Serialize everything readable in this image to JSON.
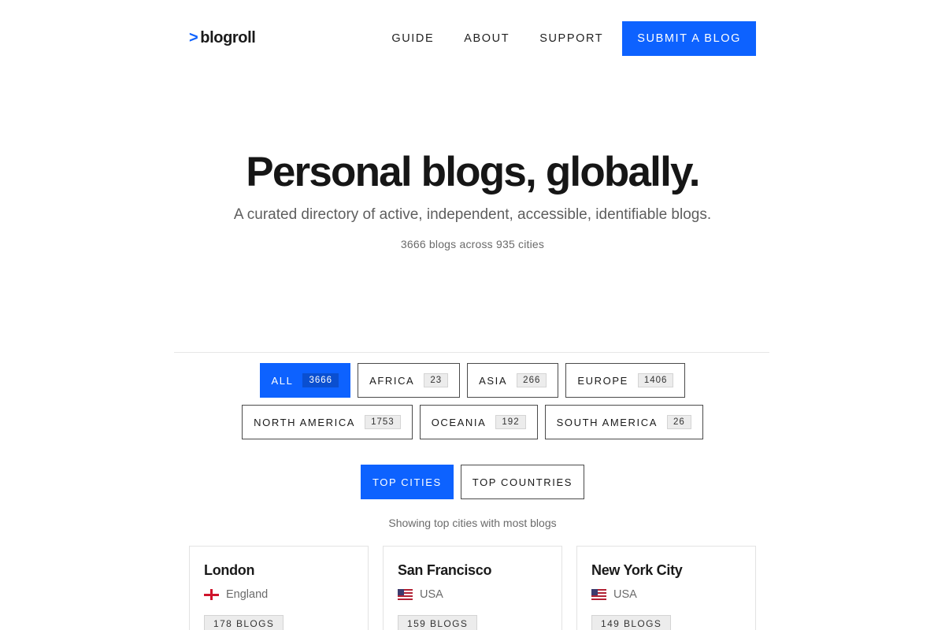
{
  "header": {
    "logo_caret": ">",
    "logo_text": "blogroll",
    "nav": [
      "GUIDE",
      "ABOUT",
      "SUPPORT"
    ],
    "submit_label": "SUBMIT A BLOG"
  },
  "hero": {
    "title": "Personal blogs, globally.",
    "subtitle": "A curated directory of active, independent, accessible, identifiable blogs.",
    "count": "3666 blogs across 935 cities"
  },
  "regions": [
    {
      "label": "ALL",
      "count": "3666",
      "active": true
    },
    {
      "label": "AFRICA",
      "count": "23"
    },
    {
      "label": "ASIA",
      "count": "266"
    },
    {
      "label": "EUROPE",
      "count": "1406"
    },
    {
      "label": "NORTH AMERICA",
      "count": "1753"
    },
    {
      "label": "OCEANIA",
      "count": "192"
    },
    {
      "label": "SOUTH AMERICA",
      "count": "26"
    }
  ],
  "toggles": {
    "top_cities": "TOP CITIES",
    "top_countries": "TOP COUNTRIES",
    "active": "top_cities"
  },
  "showing_text": "Showing top cities with most blogs",
  "cities": [
    {
      "name": "London",
      "country": "England",
      "flag": "england-flag-icon",
      "blogs": "178 BLOGS"
    },
    {
      "name": "San Francisco",
      "country": "USA",
      "flag": "usa-flag-icon",
      "blogs": "159 BLOGS"
    },
    {
      "name": "New York City",
      "country": "USA",
      "flag": "usa-flag-icon",
      "blogs": "149 BLOGS"
    }
  ],
  "colors": {
    "accent": "#0d62ff"
  }
}
